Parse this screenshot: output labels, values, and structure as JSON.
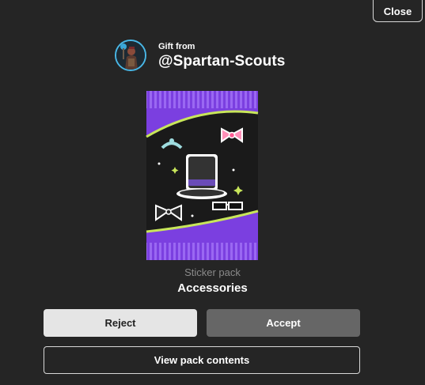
{
  "header": {
    "close_label": "Close"
  },
  "gift": {
    "from_label": "Gift from",
    "username": "@Spartan-Scouts"
  },
  "pack": {
    "type_label": "Sticker pack",
    "name": "Accessories"
  },
  "actions": {
    "reject_label": "Reject",
    "accept_label": "Accept",
    "view_contents_label": "View pack contents"
  },
  "colors": {
    "background": "#252525",
    "pack_purple": "#7b3fe0",
    "avatar_ring": "#49b7e6",
    "accept_bg": "#666666",
    "reject_bg": "#e5e5e5"
  },
  "icons": {
    "pack_stickers": [
      "top-hat-icon",
      "bow-tie-icon",
      "pink-bow-icon",
      "tiara-icon",
      "sunglasses-icon"
    ]
  }
}
